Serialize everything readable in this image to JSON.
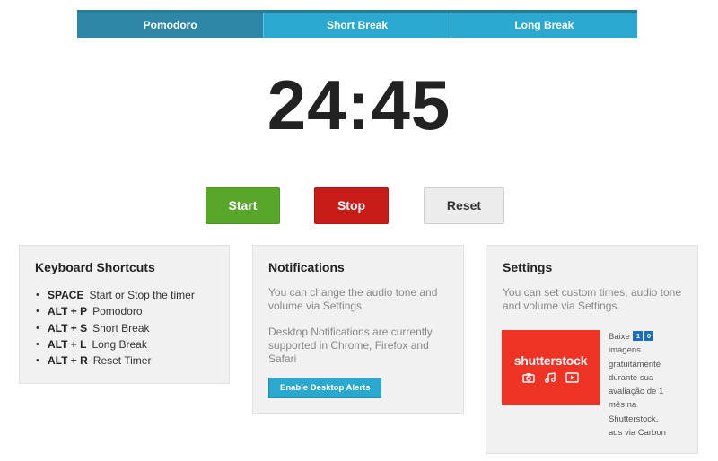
{
  "tabs": [
    {
      "label": "Pomodoro",
      "active": true
    },
    {
      "label": "Short Break",
      "active": false
    },
    {
      "label": "Long Break",
      "active": false
    }
  ],
  "timer": {
    "display": "24:45"
  },
  "controls": {
    "start_label": "Start",
    "stop_label": "Stop",
    "reset_label": "Reset"
  },
  "shortcuts_panel": {
    "title": "Keyboard Shortcuts",
    "items": [
      {
        "key": "SPACE",
        "action": "Start or Stop the timer"
      },
      {
        "key": "ALT + P",
        "action": "Pomodoro"
      },
      {
        "key": "ALT + S",
        "action": "Short Break"
      },
      {
        "key": "ALT + L",
        "action": "Long Break"
      },
      {
        "key": "ALT + R",
        "action": "Reset Timer"
      }
    ]
  },
  "notifications_panel": {
    "title": "Notifications",
    "text1": "You can change the audio tone and volume via Settings",
    "text2": "Desktop Notifications are currently supported in Chrome, Firefox and Safari",
    "button_label": "Enable Desktop Alerts"
  },
  "settings_panel": {
    "title": "Settings",
    "text": "You can set custom times, audio tone and volume via Settings."
  },
  "ad": {
    "logo_text": "shutterstock",
    "text_prefix": "Baixe",
    "digits": [
      "1",
      "0"
    ],
    "text_body": "imagens gratuitamente durante sua avaliação de 1 mês na Shutterstock.",
    "via_text": "ads via Carbon"
  },
  "colors": {
    "tab_active": "#2d88a8",
    "tab": "#2aa8cf",
    "start": "#58a62a",
    "stop": "#c81c18",
    "ad_bg": "#ee3224"
  }
}
